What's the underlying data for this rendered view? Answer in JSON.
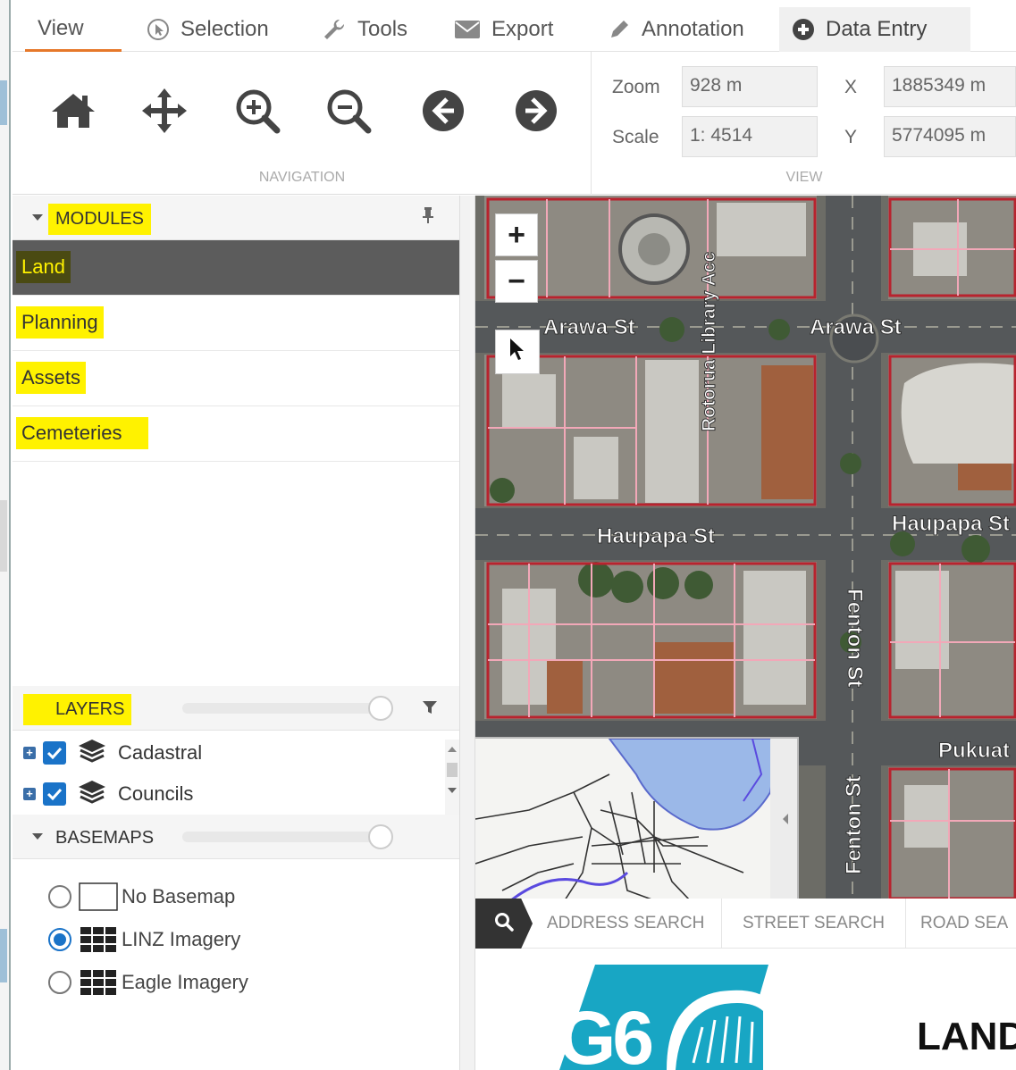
{
  "ribbon": {
    "tabs": [
      {
        "label": "View",
        "icon": "none"
      },
      {
        "label": "Selection",
        "icon": "selection-cursor-icon"
      },
      {
        "label": "Tools",
        "icon": "wrench-icon"
      },
      {
        "label": "Export",
        "icon": "envelope-icon"
      },
      {
        "label": "Annotation",
        "icon": "pencil-icon"
      },
      {
        "label": "Data Entry",
        "icon": "plus-circle-icon"
      }
    ],
    "active_tab": "View",
    "navigation_caption": "NAVIGATION",
    "view_caption": "VIEW",
    "view": {
      "zoom_label": "Zoom",
      "zoom_value": "928 m",
      "scale_label": "Scale",
      "scale_value": "1: 4514",
      "x_label": "X",
      "x_value": "1885349 m",
      "y_label": "Y",
      "y_value": "5774095 m"
    }
  },
  "modules": {
    "title": "MODULES",
    "items": [
      {
        "label": "Land",
        "active": true
      },
      {
        "label": "Planning",
        "active": false
      },
      {
        "label": "Assets",
        "active": false
      },
      {
        "label": "Cemeteries",
        "active": false
      }
    ]
  },
  "layers": {
    "title": "LAYERS",
    "opacity": 1.0,
    "items": [
      {
        "label": "Cadastral",
        "checked": true
      },
      {
        "label": "Councils",
        "checked": true
      }
    ]
  },
  "basemaps": {
    "title": "BASEMAPS",
    "opacity": 1.0,
    "items": [
      {
        "label": "No Basemap",
        "selected": false
      },
      {
        "label": "LINZ Imagery",
        "selected": true
      },
      {
        "label": "Eagle Imagery",
        "selected": false
      }
    ]
  },
  "map": {
    "zoom_in": "+",
    "zoom_out": "−",
    "streets": {
      "arawa_1": "Arawa St",
      "arawa_2": "Arawa St",
      "library": "Rotorua Library Acc",
      "haupapa_1": "Haupapa St",
      "haupapa_2": "Haupapa St",
      "fenton_1": "Fenton St",
      "fenton_2": "Fenton St",
      "pukuatua": "Pukuat"
    }
  },
  "search": {
    "tabs": [
      "ADDRESS SEARCH",
      "STREET SEARCH",
      "ROAD SEA"
    ]
  },
  "banner": {
    "logo_text": "G6",
    "title": "LAND"
  },
  "colors": {
    "highlight": "#fff200",
    "active_module_bg": "#5c5c5c",
    "accent_blue": "#1a73c8",
    "view_tab_underline": "#e6782a",
    "logo_teal": "#18a6c4"
  }
}
